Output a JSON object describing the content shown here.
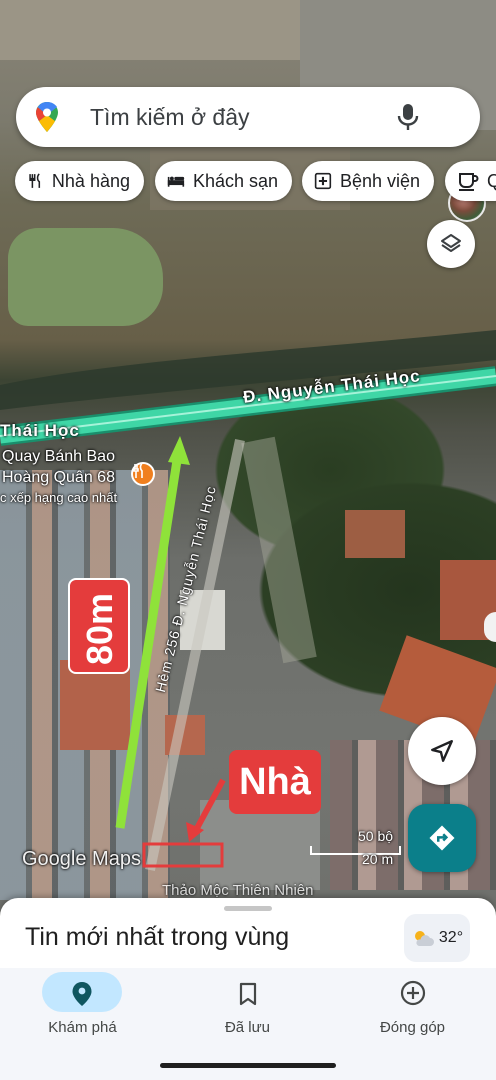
{
  "search": {
    "placeholder": "Tìm kiếm ở đây"
  },
  "chips": [
    {
      "label": "Nhà hàng",
      "icon": "restaurant-icon"
    },
    {
      "label": "Khách sạn",
      "icon": "hotel-icon"
    },
    {
      "label": "Bệnh viện",
      "icon": "hospital-icon"
    },
    {
      "label": "Q",
      "icon": "coffee-icon"
    }
  ],
  "map": {
    "road_main": "Đ. Nguyễn Thái Học",
    "road_main_left": "Thái Học",
    "road_alley": "Hẻm 256 Đ. Nguyễn Thái Học",
    "place_name_line1": "Quay Bánh Bao",
    "place_name_line2": "Hoàng Quân 68",
    "place_subtext": "c xếp hạng cao nhất",
    "bottom_label": "Thảo Mộc Thiên Nhiên",
    "attribution": "Google Maps",
    "scale_top": "50 bộ",
    "scale_bottom": "20 m",
    "annotation_distance": "80m",
    "annotation_home": "Nhà",
    "colors": {
      "road": "#3fd6a6",
      "arrow_green": "#8fe23a",
      "annotation_red": "#e43c3c"
    }
  },
  "sheet": {
    "title": "Tin mới nhất trong vùng",
    "weather_temp": "32°"
  },
  "nav": [
    {
      "label": "Khám phá",
      "icon": "location-pin-icon",
      "active": true
    },
    {
      "label": "Đã lưu",
      "icon": "bookmark-icon",
      "active": false
    },
    {
      "label": "Đóng góp",
      "icon": "add-circle-icon",
      "active": false
    }
  ]
}
